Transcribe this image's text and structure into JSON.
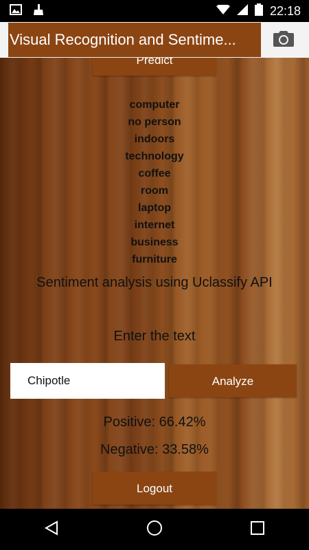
{
  "status_bar": {
    "time": "22:18"
  },
  "app_bar": {
    "title": "Visual Recognition and Sentime..."
  },
  "predict_label": "Predict",
  "tags": [
    "computer",
    "no person",
    "indoors",
    "technology",
    "coffee",
    "room",
    "laptop",
    "internet",
    "business",
    "furniture"
  ],
  "sentiment_heading": "Sentiment analysis using Uclassify API",
  "enter_text_heading": "Enter the text",
  "input": {
    "value": "Chipotle",
    "placeholder": ""
  },
  "analyze_label": "Analyze",
  "results": {
    "positive": "Positive: 66.42%",
    "negative": "Negative: 33.58%"
  },
  "logout_label": "Logout",
  "colors": {
    "accent": "#8b4513",
    "app_bar_bg": "#f3f3f3"
  }
}
